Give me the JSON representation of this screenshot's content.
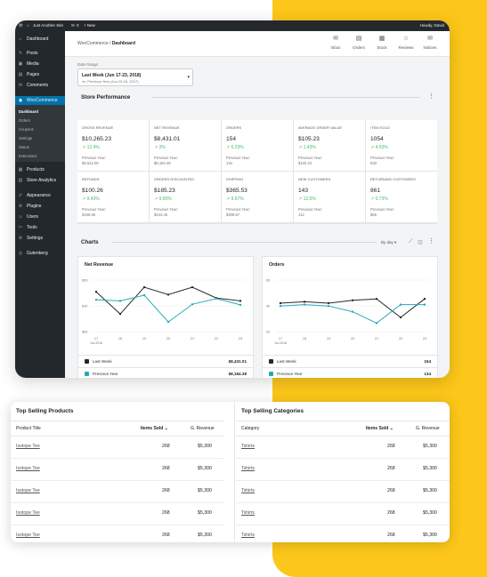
{
  "admin_bar": {
    "site": "Just Another Site",
    "comments": "0",
    "new": "+ New",
    "howdy": "Howdy, David"
  },
  "sidebar": {
    "items": [
      {
        "icon": "dashboard-icon",
        "glyph": "⌂",
        "label": "Dashboard"
      },
      {
        "icon": "pin-icon",
        "glyph": "✎",
        "label": "Posts"
      },
      {
        "icon": "media-icon",
        "glyph": "▣",
        "label": "Media"
      },
      {
        "icon": "page-icon",
        "glyph": "▤",
        "label": "Pages"
      },
      {
        "icon": "comment-icon",
        "glyph": "✉",
        "label": "Comments"
      },
      {
        "icon": "woo-icon",
        "glyph": "◉",
        "label": "WooCommerce"
      },
      {
        "icon": "product-icon",
        "glyph": "▦",
        "label": "Products"
      },
      {
        "icon": "analytics-icon",
        "glyph": "▥",
        "label": "Store Analytics"
      },
      {
        "icon": "brush-icon",
        "glyph": "✐",
        "label": "Appearance"
      },
      {
        "icon": "plugin-icon",
        "glyph": "⚙",
        "label": "Plugins"
      },
      {
        "icon": "user-icon",
        "glyph": "☺",
        "label": "Users"
      },
      {
        "icon": "wrench-icon",
        "glyph": "✂",
        "label": "Tools"
      },
      {
        "icon": "settings-icon",
        "glyph": "⚙",
        "label": "Settings"
      },
      {
        "icon": "gutenberg-icon",
        "glyph": "◎",
        "label": "Gutenberg"
      }
    ],
    "submenu": [
      "Dashboard",
      "Orders",
      "Coupons",
      "Settings",
      "Status",
      "Extensions"
    ]
  },
  "header": {
    "breadcrumb_parent": "WooCommerce / ",
    "breadcrumb_current": "Dashboard",
    "toolbar": [
      {
        "icon": "inbox-icon",
        "glyph": "✉",
        "label": "Inbox"
      },
      {
        "icon": "orders-icon",
        "glyph": "▤",
        "label": "Orders"
      },
      {
        "icon": "stock-icon",
        "glyph": "▦",
        "label": "Stock"
      },
      {
        "icon": "reviews-icon",
        "glyph": "☆",
        "label": "Reviews"
      },
      {
        "icon": "notices-icon",
        "glyph": "✉",
        "label": "Notices"
      }
    ]
  },
  "date_range": {
    "label": "Date Range:",
    "value": "Last Week (Jun 17-23, 2018)",
    "compare": "vs. Previous Year (Jun 10-16, 2017)"
  },
  "store_performance": {
    "title": "Store Performance",
    "cells": [
      {
        "label": "Gross Revenue",
        "value": "$10,265.23",
        "delta": "↗ 12.4%",
        "prev_label": "Previous Year:",
        "prev_value": "$9,542.08"
      },
      {
        "label": "Net Revenue",
        "value": "$8,431.01",
        "delta": "↗ 3%",
        "prev_label": "Previous Year:",
        "prev_value": "$8,184.38"
      },
      {
        "label": "Orders",
        "value": "154",
        "delta": "↗ 6.23%",
        "prev_label": "Previous Year:",
        "prev_value": "134"
      },
      {
        "label": "Average Order Value",
        "value": "$105.23",
        "delta": "↗ 1.43%",
        "prev_label": "Previous Year:",
        "prev_value": "$100.23"
      },
      {
        "label": "Item Sold",
        "value": "1054",
        "delta": "↗ 4.53%",
        "prev_label": "Previous Year:",
        "prev_value": "933"
      },
      {
        "label": "Refunds",
        "value": "$100.26",
        "delta": "↗ 9.43%",
        "prev_label": "Previous Year:",
        "prev_value": "$198.65"
      },
      {
        "label": "Orders Discounted",
        "value": "$185.23",
        "delta": "↗ 9.65%",
        "prev_label": "Previous Year:",
        "prev_value": "$244.45"
      },
      {
        "label": "Shipping",
        "value": "$365.53",
        "delta": "↗ 9.67%",
        "prev_label": "Previous Year:",
        "prev_value": "$308.67"
      },
      {
        "label": "New Customers",
        "value": "143",
        "delta": "↗ 12.6%",
        "prev_label": "Previous Year:",
        "prev_value": "112"
      },
      {
        "label": "Returning Customers",
        "value": "861",
        "delta": "↗ 0.73%",
        "prev_label": "Previous Year:",
        "prev_value": "$55"
      }
    ]
  },
  "charts": {
    "title": "Charts",
    "interval": "By day",
    "colors": {
      "last_week": "#23282d",
      "previous_year": "#26a9b8"
    },
    "chart_data": [
      {
        "type": "line",
        "title": "Net Revenue",
        "x": [
          "17",
          "18",
          "19",
          "20",
          "21",
          "22",
          "23"
        ],
        "x_sublabel": "Jun 2018",
        "y_ticks": [
          "$2K",
          "$1K",
          "$0K"
        ],
        "ylim": [
          0,
          2000
        ],
        "series": [
          {
            "name": "Last Week",
            "values": [
              1400,
              620,
              1560,
              1300,
              1560,
              1180,
              1080
            ]
          },
          {
            "name": "Previous Year",
            "values": [
              1120,
              1080,
              1280,
              340,
              960,
              1160,
              940
            ]
          }
        ]
      },
      {
        "type": "line",
        "title": "Orders",
        "x": [
          "17",
          "18",
          "19",
          "20",
          "21",
          "22",
          "23"
        ],
        "x_sublabel": "Jun 2018",
        "y_ticks": [
          "60",
          "40",
          "20"
        ],
        "ylim": [
          0,
          80
        ],
        "series": [
          {
            "name": "Last Week",
            "values": [
              40,
              42,
              40,
              44,
              46,
              20,
              46
            ]
          },
          {
            "name": "Previous Year",
            "values": [
              36,
              38,
              36,
              28,
              12,
              38,
              38
            ]
          }
        ]
      }
    ],
    "legends": [
      [
        {
          "name": "Last Week",
          "value": "$8,431.01"
        },
        {
          "name": "Previous Year",
          "value": "$8,184.38"
        }
      ],
      [
        {
          "name": "Last Week",
          "value": "154"
        },
        {
          "name": "Previous Year",
          "value": "134"
        }
      ]
    ]
  },
  "top_products": {
    "title": "Top Selling Products",
    "headers": [
      "Product Title",
      "Items Sold ⌄",
      "G. Revenue"
    ],
    "rows": [
      [
        "Isotope Tee",
        "268",
        "$5,300"
      ],
      [
        "Isotope Tee",
        "268",
        "$5,300"
      ],
      [
        "Isotope Tee",
        "268",
        "$5,300"
      ],
      [
        "Isotope Tee",
        "268",
        "$5,300"
      ],
      [
        "Isotope Tee",
        "268",
        "$5,300"
      ]
    ]
  },
  "top_categories": {
    "title": "Top Selling Categories",
    "headers": [
      "Category",
      "Items Sold ⌄",
      "G. Revenue"
    ],
    "rows": [
      [
        "Tshirts",
        "268",
        "$5,300"
      ],
      [
        "Tshirts",
        "268",
        "$5,300"
      ],
      [
        "Tshirts",
        "268",
        "$5,300"
      ],
      [
        "Tshirts",
        "268",
        "$5,300"
      ],
      [
        "Tshirts",
        "268",
        "$5,300"
      ]
    ]
  }
}
